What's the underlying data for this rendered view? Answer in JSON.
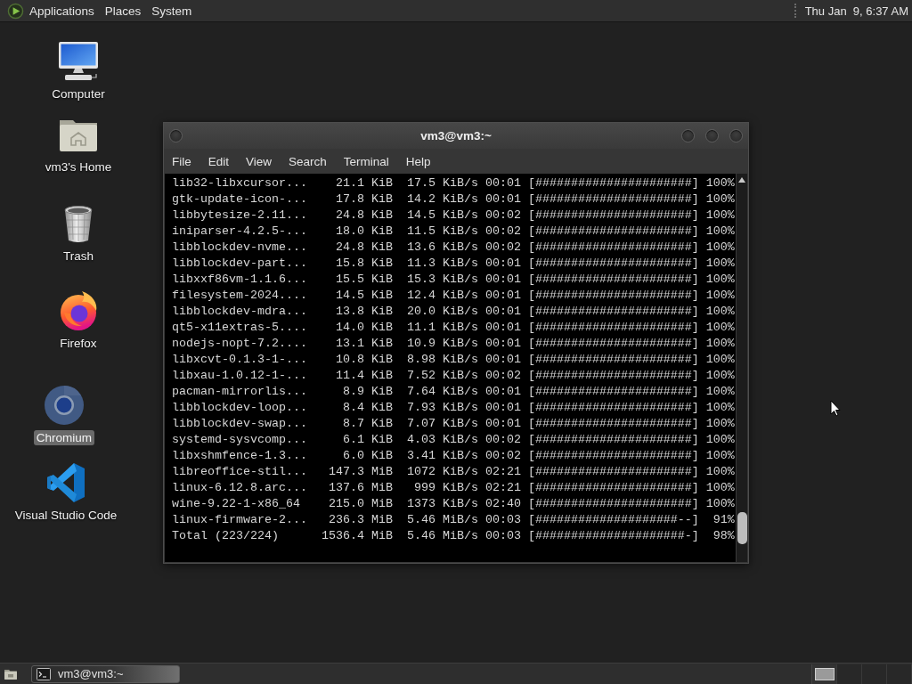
{
  "top_panel": {
    "menus": [
      "Applications",
      "Places",
      "System"
    ],
    "clock": "Thu Jan  9, 6:37 AM"
  },
  "desktop_icons": [
    {
      "kind": "computer",
      "label": "Computer",
      "selected": false
    },
    {
      "kind": "home",
      "label": "vm3's Home",
      "selected": false
    },
    {
      "kind": "trash",
      "label": "Trash",
      "selected": false
    },
    {
      "kind": "firefox",
      "label": "Firefox",
      "selected": false
    },
    {
      "kind": "chromium",
      "label": "Chromium",
      "selected": true
    },
    {
      "kind": "vscode",
      "label": "Visual Studio Code",
      "selected": false
    }
  ],
  "terminal": {
    "title": "vm3@vm3:~",
    "menu": [
      "File",
      "Edit",
      "View",
      "Search",
      "Terminal",
      "Help"
    ],
    "lines": [
      "lib32-libxcursor...    21.1 KiB  17.5 KiB/s 00:01 [######################] 100%",
      "gtk-update-icon-...    17.8 KiB  14.2 KiB/s 00:01 [######################] 100%",
      "libbytesize-2.11...    24.8 KiB  14.5 KiB/s 00:02 [######################] 100%",
      "iniparser-4.2.5-...    18.0 KiB  11.5 KiB/s 00:02 [######################] 100%",
      "libblockdev-nvme...    24.8 KiB  13.6 KiB/s 00:02 [######################] 100%",
      "libblockdev-part...    15.8 KiB  11.3 KiB/s 00:01 [######################] 100%",
      "libxxf86vm-1.1.6...    15.5 KiB  15.3 KiB/s 00:01 [######################] 100%",
      "filesystem-2024....    14.5 KiB  12.4 KiB/s 00:01 [######################] 100%",
      "libblockdev-mdra...    13.8 KiB  20.0 KiB/s 00:01 [######################] 100%",
      "qt5-x11extras-5....    14.0 KiB  11.1 KiB/s 00:01 [######################] 100%",
      "nodejs-nopt-7.2....    13.1 KiB  10.9 KiB/s 00:01 [######################] 100%",
      "libxcvt-0.1.3-1-...    10.8 KiB  8.98 KiB/s 00:01 [######################] 100%",
      "libxau-1.0.12-1-...    11.4 KiB  7.52 KiB/s 00:02 [######################] 100%",
      "pacman-mirrorlis...     8.9 KiB  7.64 KiB/s 00:01 [######################] 100%",
      "libblockdev-loop...     8.4 KiB  7.93 KiB/s 00:01 [######################] 100%",
      "libblockdev-swap...     8.7 KiB  7.07 KiB/s 00:01 [######################] 100%",
      "systemd-sysvcomp...     6.1 KiB  4.03 KiB/s 00:02 [######################] 100%",
      "libxshmfence-1.3...     6.0 KiB  3.41 KiB/s 00:02 [######################] 100%",
      "libreoffice-stil...   147.3 MiB  1072 KiB/s 02:21 [######################] 100%",
      "linux-6.12.8.arc...   137.6 MiB   999 KiB/s 02:21 [######################] 100%",
      "wine-9.22-1-x86_64    215.0 MiB  1373 KiB/s 02:40 [######################] 100%",
      "linux-firmware-2...   236.3 MiB  5.46 MiB/s 00:03 [####################--]  91%",
      "Total (223/224)      1536.4 MiB  5.46 MiB/s 00:03 [#####################-]  98%"
    ]
  },
  "taskbar": {
    "tasks": [
      {
        "label": "vm3@vm3:~",
        "selected": true
      }
    ]
  }
}
